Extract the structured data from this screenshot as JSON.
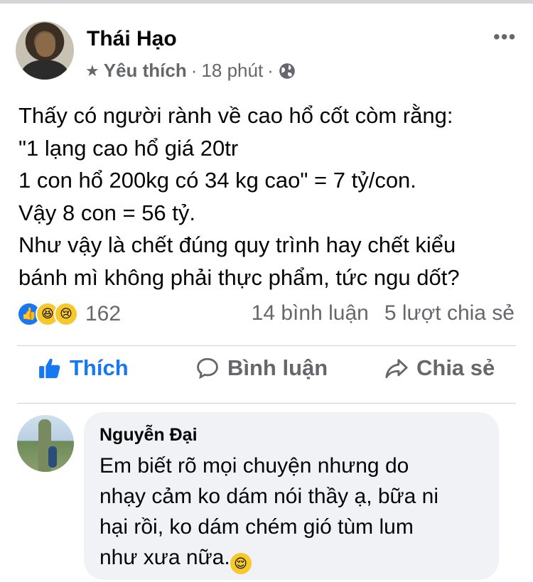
{
  "post": {
    "author": "Thái Hạo",
    "favorite_label": "Yêu thích",
    "meta_sep": "·",
    "time": "18 phút",
    "body_lines": [
      "Thấy có người rành về cao hổ cốt còm rằng:",
      "\"1 lạng cao hổ giá 20tr",
      "1 con hổ 200kg có 34 kg cao\" = 7 tỷ/con.",
      "Vậy 8 con = 56 tỷ.",
      "Như vậy là chết đúng quy trình hay chết kiểu",
      "bánh mì không phải thực phẩm, tức ngu dốt?"
    ]
  },
  "stats": {
    "reaction_count": "162",
    "comments": "14 bình luận",
    "shares": "5 lượt chia sẻ"
  },
  "actions": {
    "like": "Thích",
    "comment": "Bình luận",
    "share": "Chia sẻ"
  },
  "comment": {
    "author": "Nguyễn Đại",
    "lines": [
      "Em biết rõ mọi chuyện nhưng do",
      "nhạy cảm ko dám nói thầy ạ, bữa ni",
      "hại rồi, ko dám chém gió tùm lum",
      "như xưa nữa."
    ],
    "emoji": "relieved-face"
  },
  "colors": {
    "accent": "#1877f2",
    "secondary_text": "#65676b",
    "bubble": "#f0f2f5"
  }
}
